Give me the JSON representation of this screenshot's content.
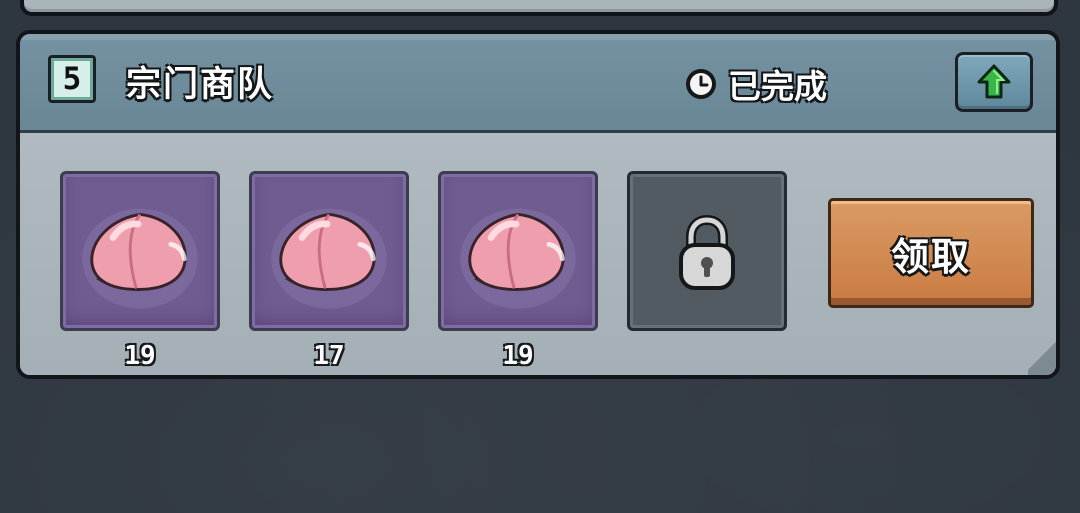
{
  "task": {
    "level": "5",
    "title": "宗门商队",
    "status": "已完成",
    "claim_label": "领取",
    "upgrade_icon": "arrow-up-icon",
    "status_icon": "clock-icon"
  },
  "rewards": [
    {
      "item": "peach",
      "count": "19"
    },
    {
      "item": "peach",
      "count": "17"
    },
    {
      "item": "peach",
      "count": "19"
    }
  ],
  "locked_slot": {
    "icon": "lock-icon"
  },
  "colors": {
    "header": "#6f8c9b",
    "reward_slot": "#6f5c91",
    "claim_button": "#d08a56",
    "upgrade_arrow": "#39b54a"
  }
}
